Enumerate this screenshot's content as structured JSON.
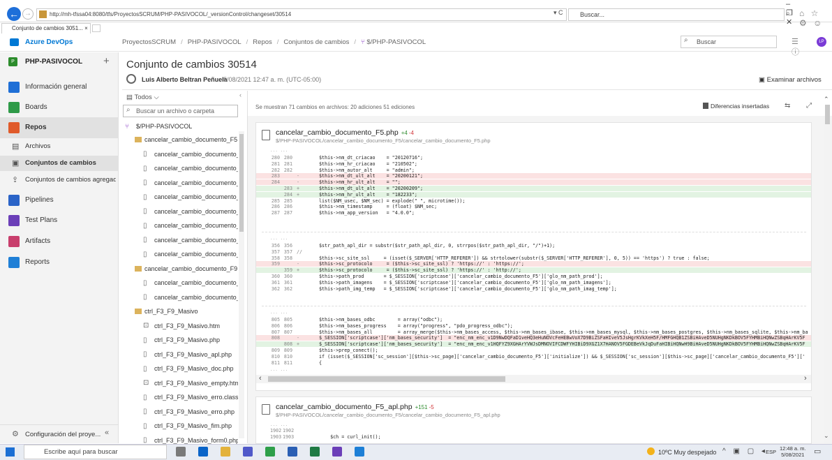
{
  "browser": {
    "url": "http://mh-tfssa04:8080/tfs/ProyectosSCRUM/PHP-PASIVOCOL/_versionControl/changeset/30514",
    "addr_tools": "▾ C",
    "search_placeholder": "Buscar...",
    "tab_title": "Conjunto de cambios 3051...",
    "tab_close": "×",
    "window_controls": "– ❐ ✕",
    "right_icons": "⌂ ☆ ⚙ ☺"
  },
  "header": {
    "brand": "Azure DevOps",
    "breadcrumb": [
      "ProyectosSCRUM",
      "PHP-PASIVOCOL",
      "Repos",
      "Conjuntos de cambios",
      "$/PHP-PASIVOCOL"
    ],
    "breadcrumb_sep": "/",
    "search_placeholder": "Buscar",
    "avatar_initials": "LP",
    "icons": "☰ ⓘ"
  },
  "nav": {
    "project_badge": "P",
    "project_name": "PHP-PASIVOCOL",
    "add": "+",
    "items": [
      {
        "label": "Información general",
        "icon": "overview-icon",
        "color": "#1f6fd6"
      },
      {
        "label": "Boards",
        "icon": "boards-icon",
        "color": "#2e9a48"
      },
      {
        "label": "Repos",
        "icon": "repos-icon",
        "color": "#e05a2a"
      },
      {
        "label": "Pipelines",
        "icon": "pipelines-icon",
        "color": "#2a63c7"
      },
      {
        "label": "Test Plans",
        "icon": "testplans-icon",
        "color": "#6b3fb8"
      },
      {
        "label": "Artifacts",
        "icon": "artifacts-icon",
        "color": "#c83e6c"
      },
      {
        "label": "Reports",
        "icon": "reports-icon",
        "color": "#1f7fd6"
      }
    ],
    "sub_items": [
      {
        "label": "Archivos",
        "icon": "▤"
      },
      {
        "label": "Conjuntos de cambios",
        "icon": "▣"
      },
      {
        "label": "Conjuntos de cambios agregad...",
        "icon": "⇪"
      }
    ],
    "config_label": "Configuración del proye...",
    "config_icon": "⚙",
    "collapse": "«"
  },
  "page": {
    "title": "Conjunto de cambios 30514",
    "author": "Luis Alberto Beltran Peñuela",
    "date": "5/08/2021 12:47 a. m. (UTC-05:00)",
    "browse": "Examinar archivos"
  },
  "tree": {
    "filter": "Todos",
    "filter_chevron": "⌵",
    "collapse": "‹",
    "search_placeholder": "Buscar un archivo o carpeta",
    "root": "$/PHP-PASIVOCOL",
    "nodes": [
      {
        "label": "cancelar_cambio_documento_F5",
        "type": "folder",
        "level": 1
      },
      {
        "label": "cancelar_cambio_documento_...",
        "type": "file",
        "level": 2
      },
      {
        "label": "cancelar_cambio_documento_...",
        "type": "file",
        "level": 2
      },
      {
        "label": "cancelar_cambio_documento_...",
        "type": "file",
        "level": 2
      },
      {
        "label": "cancelar_cambio_documento_...",
        "type": "file",
        "level": 2
      },
      {
        "label": "cancelar_cambio_documento_...",
        "type": "file",
        "level": 2
      },
      {
        "label": "cancelar_cambio_documento_...",
        "type": "file",
        "level": 2
      },
      {
        "label": "cancelar_cambio_documento_...",
        "type": "file",
        "level": 2
      },
      {
        "label": "cancelar_cambio_documento_...",
        "type": "file",
        "level": 2
      },
      {
        "label": "cancelar_cambio_documento_F9",
        "type": "folder",
        "level": 1
      },
      {
        "label": "cancelar_cambio_documento_...",
        "type": "file",
        "level": 2
      },
      {
        "label": "cancelar_cambio_documento_...",
        "type": "file",
        "level": 2
      },
      {
        "label": "ctrl_F3_F9_Masivo",
        "type": "folder",
        "level": 1
      },
      {
        "label": "ctrl_F3_F9_Masivo.htm",
        "type": "html",
        "level": 2
      },
      {
        "label": "ctrl_F3_F9_Masivo.php",
        "type": "file",
        "level": 2
      },
      {
        "label": "ctrl_F3_F9_Masivo_apl.php",
        "type": "file",
        "level": 2
      },
      {
        "label": "ctrl_F3_F9_Masivo_doc.php",
        "type": "file",
        "level": 2
      },
      {
        "label": "ctrl_F3_F9_Masivo_empty.htm",
        "type": "html",
        "level": 2
      },
      {
        "label": "ctrl_F3_F9_Masivo_erro.class.p...",
        "type": "file",
        "level": 2
      },
      {
        "label": "ctrl_F3_F9_Masivo_erro.php",
        "type": "file",
        "level": 2
      },
      {
        "label": "ctrl_F3_F9_Masivo_fim.php",
        "type": "file",
        "level": 2
      },
      {
        "label": "ctrl_F3_F9_Masivo_form0.php",
        "type": "file",
        "level": 2
      }
    ]
  },
  "diff": {
    "summary": "Se muestran 71 cambios en archivos: 20 adiciones 51 ediciones",
    "mode": "Diferencias insertadas",
    "mode_icons": "⇆ ⤢",
    "ellipsis": "... ...",
    "file1": {
      "name": "cancelar_cambio_documento_F5.php",
      "adds": "+4",
      "dels": "-4",
      "path": "$/PHP-PASIVOCOL/cancelar_cambio_documento_F5/cancelar_cambio_documento_F5.php",
      "hunks": [
        [
          {
            "l1": "280",
            "l2": "280",
            "m": "",
            "t": "$this->nm_dt_criacao    = \"20120716\";",
            "k": ""
          },
          {
            "l1": "281",
            "l2": "281",
            "m": "",
            "t": "$this->nm_hr_criacao    = \"210502\";",
            "k": ""
          },
          {
            "l1": "282",
            "l2": "282",
            "m": "",
            "t": "$this->nm_autor_alt     = \"admin\";",
            "k": ""
          },
          {
            "l1": "283",
            "l2": "",
            "m": "-",
            "t": "$this->nm_dt_ult_alt    = \"20200121\";",
            "k": "del"
          },
          {
            "l1": "284",
            "l2": "",
            "m": "-",
            "t": "$this->nm_hr_ult_alt    = \"\";",
            "k": "del"
          },
          {
            "l1": "",
            "l2": "283",
            "m": "+",
            "t": "$this->nm_dt_ult_alt    = \"20200209\";",
            "k": "add"
          },
          {
            "l1": "",
            "l2": "284",
            "m": "+",
            "t": "$this->nm_hr_ult_alt    = \"182233\";",
            "k": "add"
          },
          {
            "l1": "285",
            "l2": "285",
            "m": "",
            "t": "list($NM_usec, $NM_sec) = explode(\" \", microtime());",
            "k": ""
          },
          {
            "l1": "286",
            "l2": "286",
            "m": "",
            "t": "$this->nm_timestamp     = (float) $NM_sec;",
            "k": ""
          },
          {
            "l1": "287",
            "l2": "287",
            "m": "",
            "t": "$this->nm_app_version   = \"4.0.0\";",
            "k": ""
          }
        ],
        [
          {
            "l1": "356",
            "l2": "356",
            "m": "",
            "t": "$str_path_apl_dir = substr($str_path_apl_dir, 0, strrpos($str_path_apl_dir, \"/\")+1);",
            "k": ""
          },
          {
            "l1": "357",
            "l2": "357",
            "m": "//",
            "t": "",
            "k": ""
          },
          {
            "l1": "358",
            "l2": "358",
            "m": "",
            "t": "$this->sc_site_ssl     = (isset($_SERVER['HTTP_REFERER']) && strtolower(substr($_SERVER['HTTP_REFERER'], 0, 5)) == 'https') ? true : false;",
            "k": ""
          },
          {
            "l1": "359",
            "l2": "",
            "m": "-",
            "t": "$this->sc_protocolo     = ($this->sc_site_ssl) ? 'https://' : 'https://';",
            "k": "del"
          },
          {
            "l1": "",
            "l2": "359",
            "m": "+",
            "t": "$this->sc_protocolo     = ($this->sc_site_ssl) ? 'https://' : 'http://';",
            "k": "add"
          },
          {
            "l1": "360",
            "l2": "360",
            "m": "",
            "t": "$this->path_prod       = $_SESSION['scriptcase']['cancelar_cambio_documento_F5']['glo_nm_path_prod'];",
            "k": ""
          },
          {
            "l1": "361",
            "l2": "361",
            "m": "",
            "t": "$this->path_imagens    = $_SESSION['scriptcase']['cancelar_cambio_documento_F5']['glo_nm_path_imagens'];",
            "k": ""
          },
          {
            "l1": "362",
            "l2": "362",
            "m": "",
            "t": "$this->path_img_temp   = $_SESSION['scriptcase']['cancelar_cambio_documento_F5']['glo_nm_path_imag_temp'];",
            "k": ""
          }
        ],
        [
          {
            "l1": "805",
            "l2": "805",
            "m": "",
            "t": "$this->nm_bases_odbc        = array(\"odbc\");",
            "k": ""
          },
          {
            "l1": "806",
            "l2": "806",
            "m": "",
            "t": "$this->nm_bases_progress    = array(\"progress\", \"pdo_progress_odbc\");",
            "k": ""
          },
          {
            "l1": "807",
            "l2": "807",
            "m": "",
            "t": "$this->nm_bases_all         = array_merge($this->nm_bases_access, $this->nm_bases_ibase, $this->nm_bases_mysql, $this->nm_bases_postgres, $this->nm_bases_sqlite, $this->nm_ba",
            "k": ""
          },
          {
            "l1": "808",
            "l2": "",
            "m": "-",
            "t": "$_SESSION['scriptcase']['nm_bases_security']  = \"enc_nm_enc_v1D9NwDQFaD1veHQ3eHuNOVcFeHEBwVoX7D9BiZSFaHIveV5JsHgrKVkXeH5F/HMFGHQB1ZSBiHAveD5NUHgNKDkBOV5FYHMBiHQNwZSBqHArKV5F",
            "k": "del"
          },
          {
            "l1": "",
            "l2": "808",
            "m": "+",
            "t": "$_SESSION['scriptcase']['nm_bases_security']  = \"enc_nm_enc_v1HQFYZ9XGHArYVWJsDMNOVIFCDWFYHIBiD9XGZ1X7HANOV5FGDEBeVkJqDuFaHIBiHQNwH9BiHAveD5NUHgNKDkBOV5FYHMBiHQNwZSBqHArKV5F",
            "k": "add"
          },
          {
            "l1": "809",
            "l2": "809",
            "m": "",
            "t": "$this->prep_conect();",
            "k": ""
          },
          {
            "l1": "810",
            "l2": "810",
            "m": "",
            "t": "if (isset($_SESSION['sc_session'][$this->sc_page]['cancelar_cambio_documento_F5']['initialize']) && $_SESSION['sc_session'][$this->sc_page]['cancelar_cambio_documento_F5']['",
            "k": ""
          },
          {
            "l1": "811",
            "l2": "811",
            "m": "",
            "t": "{",
            "k": ""
          }
        ]
      ]
    },
    "file2": {
      "name": "cancelar_cambio_documento_F5_apl.php",
      "adds": "+151",
      "dels": "-5",
      "path": "$/PHP-PASIVOCOL/cancelar_cambio_documento_F5/cancelar_cambio_documento_F5_apl.php",
      "lines": [
        {
          "l1": "1902",
          "l2": "1902",
          "m": "",
          "t": "",
          "k": ""
        },
        {
          "l1": "1903",
          "l2": "1903",
          "m": "",
          "t": "    $ch = curl_init();",
          "k": ""
        }
      ]
    }
  },
  "taskbar": {
    "search_placeholder": "Escribe aquí para buscar",
    "weather": "10ºC  Muy despejado",
    "tray_icons": "^ ▣ ▢ ◂",
    "lang": "ESP",
    "time": "12:48 a. m.",
    "date": "5/08/2021",
    "apps": [
      {
        "name": "task-view-icon",
        "color": "#7a7a7a"
      },
      {
        "name": "outlook-icon",
        "color": "#0a64c8"
      },
      {
        "name": "file-explorer-icon",
        "color": "#e3b23c"
      },
      {
        "name": "teams-icon",
        "color": "#5059c9"
      },
      {
        "name": "chrome-icon",
        "color": "#2e9f4a"
      },
      {
        "name": "word-icon",
        "color": "#2b5fb4"
      },
      {
        "name": "excel-icon",
        "color": "#1f7a44"
      },
      {
        "name": "visual-studio-icon",
        "color": "#6b3fb8"
      },
      {
        "name": "internet-explorer-icon",
        "color": "#1d7fd6"
      }
    ]
  }
}
